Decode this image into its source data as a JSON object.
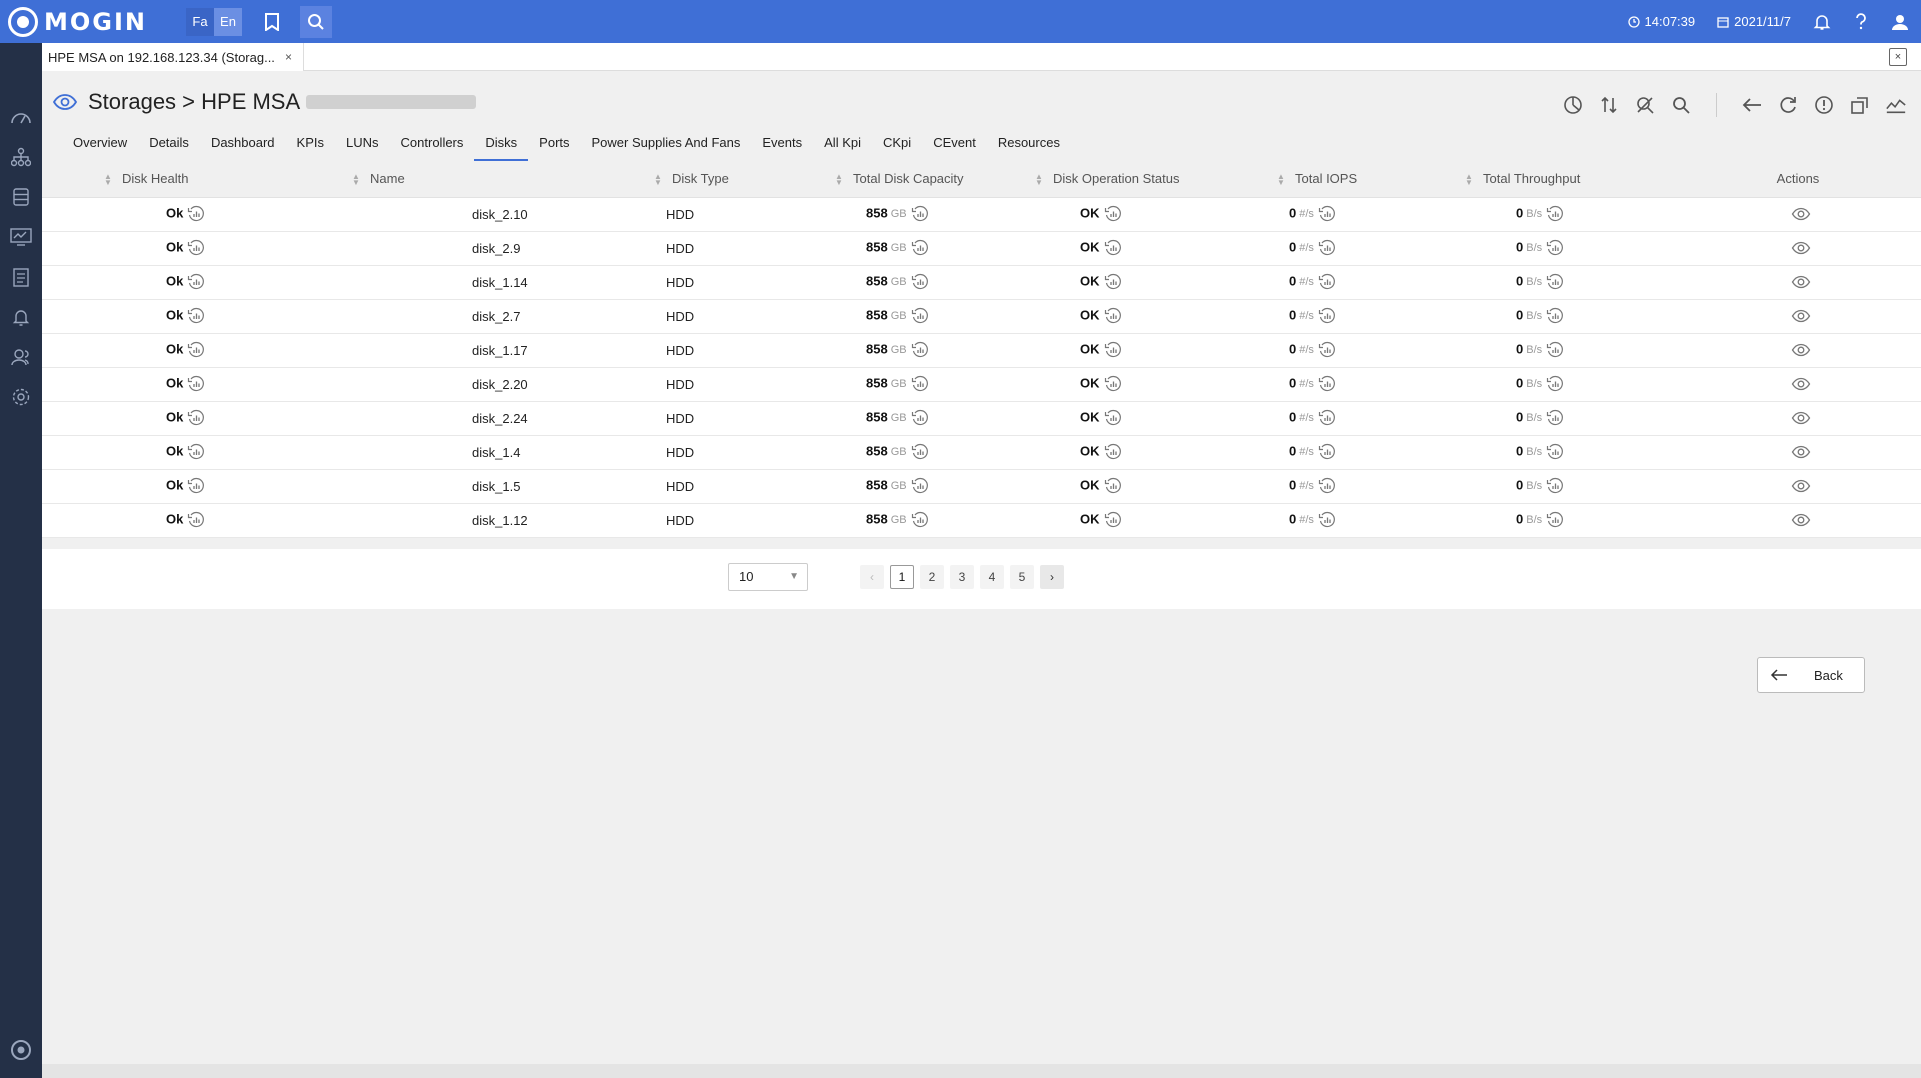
{
  "app": {
    "logo_text": "MOGIN",
    "lang_fa": "Fa",
    "lang_en": "En",
    "time": "14:07:39",
    "date": "2021/11/7"
  },
  "doc_tab": {
    "label": "HPE MSA on 192.168.123.34 (Storag...",
    "close": "×"
  },
  "page": {
    "title": "Storages > HPE MSA"
  },
  "tabs": [
    "Overview",
    "Details",
    "Dashboard",
    "KPIs",
    "LUNs",
    "Controllers",
    "Disks",
    "Ports",
    "Power Supplies And Fans",
    "Events",
    "All Kpi",
    "CKpi",
    "CEvent",
    "Resources"
  ],
  "active_tab": "Disks",
  "table": {
    "headers": [
      "Disk Health",
      "Name",
      "Disk Type",
      "Total Disk Capacity",
      "Disk Operation Status",
      "Total IOPS",
      "Total Throughput",
      "Actions"
    ],
    "rows": [
      {
        "health": "Ok",
        "name": "disk_2.10",
        "type": "HDD",
        "capacity": "858",
        "cap_unit": "GB",
        "status": "OK",
        "iops": "0",
        "iops_unit": "#/s",
        "thr": "0",
        "thr_unit": "B/s"
      },
      {
        "health": "Ok",
        "name": "disk_2.9",
        "type": "HDD",
        "capacity": "858",
        "cap_unit": "GB",
        "status": "OK",
        "iops": "0",
        "iops_unit": "#/s",
        "thr": "0",
        "thr_unit": "B/s"
      },
      {
        "health": "Ok",
        "name": "disk_1.14",
        "type": "HDD",
        "capacity": "858",
        "cap_unit": "GB",
        "status": "OK",
        "iops": "0",
        "iops_unit": "#/s",
        "thr": "0",
        "thr_unit": "B/s"
      },
      {
        "health": "Ok",
        "name": "disk_2.7",
        "type": "HDD",
        "capacity": "858",
        "cap_unit": "GB",
        "status": "OK",
        "iops": "0",
        "iops_unit": "#/s",
        "thr": "0",
        "thr_unit": "B/s"
      },
      {
        "health": "Ok",
        "name": "disk_1.17",
        "type": "HDD",
        "capacity": "858",
        "cap_unit": "GB",
        "status": "OK",
        "iops": "0",
        "iops_unit": "#/s",
        "thr": "0",
        "thr_unit": "B/s"
      },
      {
        "health": "Ok",
        "name": "disk_2.20",
        "type": "HDD",
        "capacity": "858",
        "cap_unit": "GB",
        "status": "OK",
        "iops": "0",
        "iops_unit": "#/s",
        "thr": "0",
        "thr_unit": "B/s"
      },
      {
        "health": "Ok",
        "name": "disk_2.24",
        "type": "HDD",
        "capacity": "858",
        "cap_unit": "GB",
        "status": "OK",
        "iops": "0",
        "iops_unit": "#/s",
        "thr": "0",
        "thr_unit": "B/s"
      },
      {
        "health": "Ok",
        "name": "disk_1.4",
        "type": "HDD",
        "capacity": "858",
        "cap_unit": "GB",
        "status": "OK",
        "iops": "0",
        "iops_unit": "#/s",
        "thr": "0",
        "thr_unit": "B/s"
      },
      {
        "health": "Ok",
        "name": "disk_1.5",
        "type": "HDD",
        "capacity": "858",
        "cap_unit": "GB",
        "status": "OK",
        "iops": "0",
        "iops_unit": "#/s",
        "thr": "0",
        "thr_unit": "B/s"
      },
      {
        "health": "Ok",
        "name": "disk_1.12",
        "type": "HDD",
        "capacity": "858",
        "cap_unit": "GB",
        "status": "OK",
        "iops": "0",
        "iops_unit": "#/s",
        "thr": "0",
        "thr_unit": "B/s"
      }
    ]
  },
  "pagination": {
    "page_size": "10",
    "pages": [
      "1",
      "2",
      "3",
      "4",
      "5"
    ],
    "current": "1"
  },
  "back_label": "Back",
  "colors": {
    "topbar": "#3f6fd6",
    "rail": "#243047",
    "accent": "#3f6fd6"
  },
  "icons": {
    "topbar": [
      "bookmark-icon",
      "search-icon",
      "clock-icon",
      "calendar-icon",
      "bell-icon",
      "help-icon",
      "user-icon"
    ],
    "rail": [
      "dashboard-icon",
      "topology-icon",
      "database-icon",
      "monitor-icon",
      "report-icon",
      "alarm-icon",
      "users-icon",
      "settings-icon",
      "logo-icon"
    ],
    "toolbar": [
      "chart-pie-icon",
      "sort-icon",
      "no-search-icon",
      "search-icon",
      "arrow-left-icon",
      "refresh-icon",
      "info-icon",
      "export-icon",
      "trend-icon"
    ],
    "cell": "history-chart-icon",
    "action": "eye-icon"
  }
}
